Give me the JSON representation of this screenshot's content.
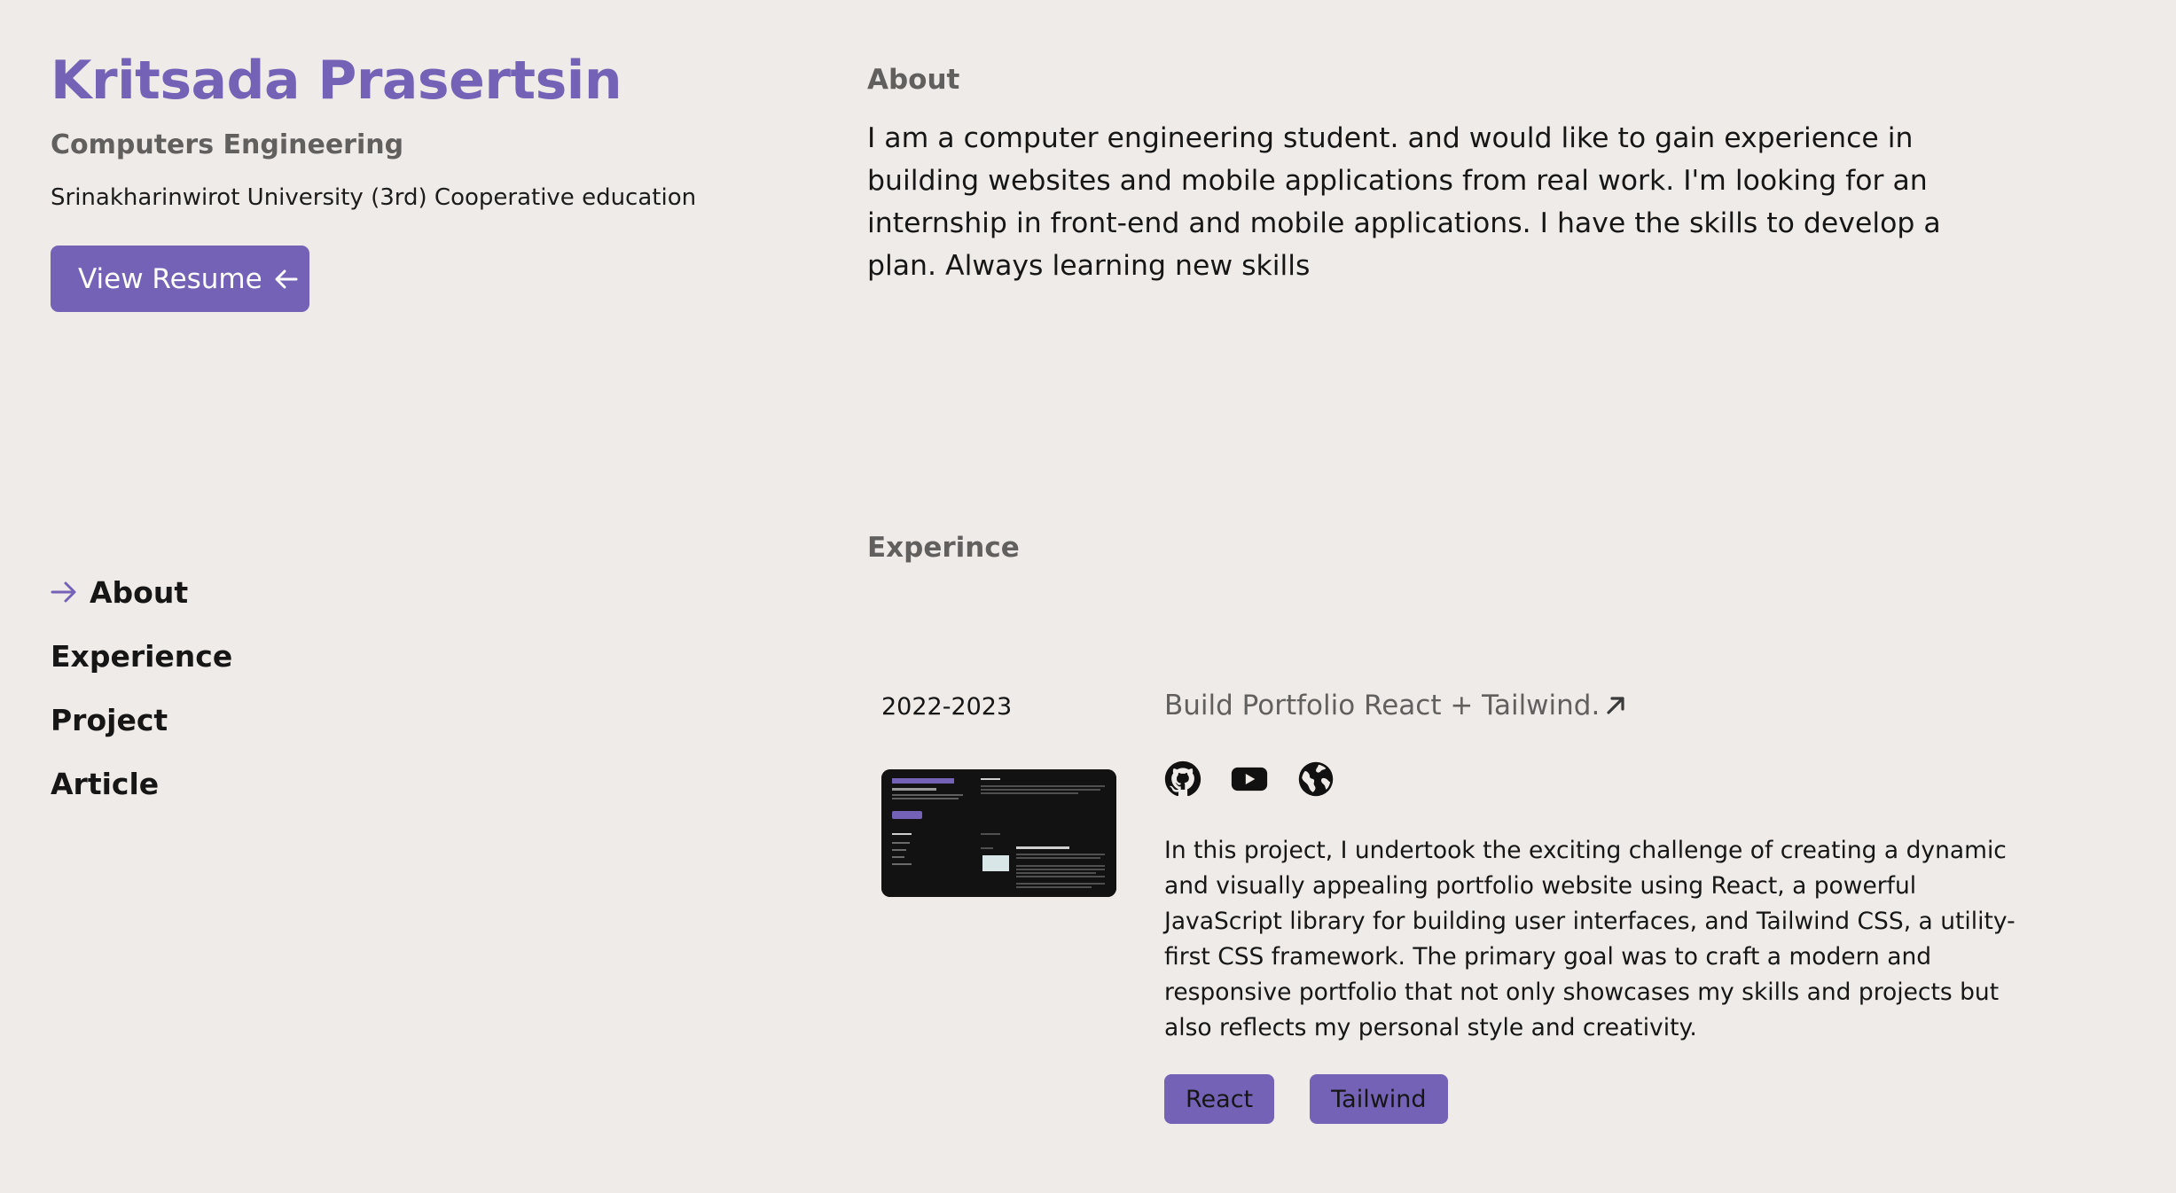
{
  "profile": {
    "name": "Kritsada Prasertsin",
    "role": "Computers Engineering",
    "education": "Srinakharinwirot University (3rd) Cooperative education",
    "resume_button": "View Resume"
  },
  "nav": {
    "items": [
      {
        "label": "About",
        "active": true
      },
      {
        "label": "Experience",
        "active": false
      },
      {
        "label": "Project",
        "active": false
      },
      {
        "label": "Article",
        "active": false
      }
    ]
  },
  "about": {
    "title": "About",
    "text": "I am a computer engineering student. and would like to gain experience in building websites and mobile applications from real work. I'm looking for an internship in front-end and mobile applications. I have the skills to develop a plan. Always learning new skills"
  },
  "experience": {
    "title": "Experince",
    "items": [
      {
        "date": "2022-2023",
        "title": "Build Portfolio React + Tailwind.",
        "links": [
          "github-icon",
          "youtube-icon",
          "globe-icon"
        ],
        "description": "In this project, I undertook the exciting challenge of creating a dynamic and visually appealing portfolio website using React, a powerful JavaScript library for building user interfaces, and Tailwind CSS, a utility-first CSS framework. The primary goal was to craft a modern and responsive portfolio that not only showcases my skills and projects but also reflects my personal style and creativity.",
        "tags": [
          "React",
          "Tailwind"
        ]
      }
    ]
  },
  "colors": {
    "accent": "#7462b7",
    "background": "#efebe8",
    "muted": "#625f5f",
    "text": "#161616"
  }
}
